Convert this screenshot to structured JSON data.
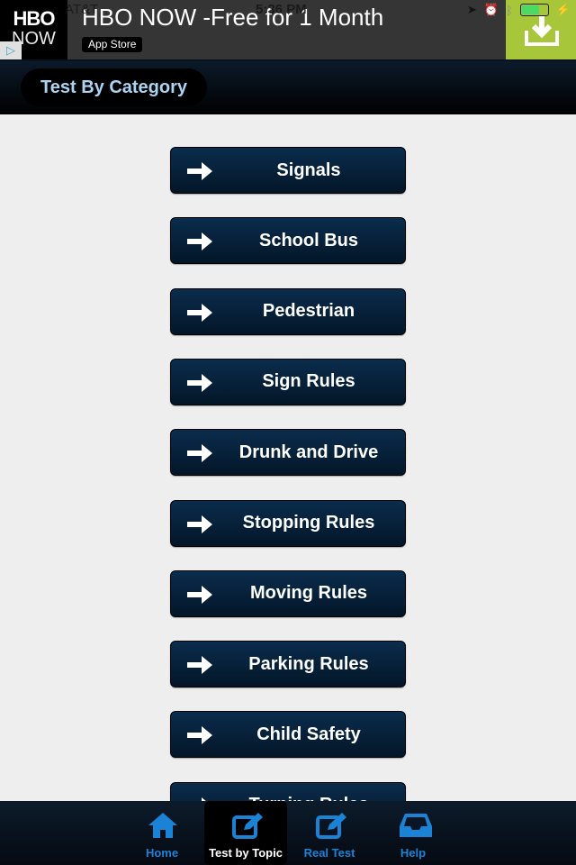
{
  "status_bar": {
    "carrier": "AT&T",
    "time": "5:36 PM",
    "battery_percent": 70
  },
  "ad": {
    "logo_line1": "HBO",
    "logo_line2": "NOW",
    "title": "HBO NOW -Free for 1 Month",
    "store_label": "App Store",
    "adchoice": "▷"
  },
  "header": {
    "title": "Test By Category"
  },
  "categories": [
    {
      "label": "Signals"
    },
    {
      "label": "School Bus"
    },
    {
      "label": "Pedestrian"
    },
    {
      "label": "Sign Rules"
    },
    {
      "label": "Drunk and Drive"
    },
    {
      "label": "Stopping Rules"
    },
    {
      "label": "Moving Rules"
    },
    {
      "label": "Parking Rules"
    },
    {
      "label": "Child Safety"
    },
    {
      "label": "Turning Rules"
    }
  ],
  "tabs": [
    {
      "label": "Home",
      "icon": "home-icon",
      "active": false
    },
    {
      "label": "Test by Topic",
      "icon": "edit-icon",
      "active": true
    },
    {
      "label": "Real Test",
      "icon": "edit-icon",
      "active": false
    },
    {
      "label": "Help",
      "icon": "inbox-icon",
      "active": false
    }
  ]
}
